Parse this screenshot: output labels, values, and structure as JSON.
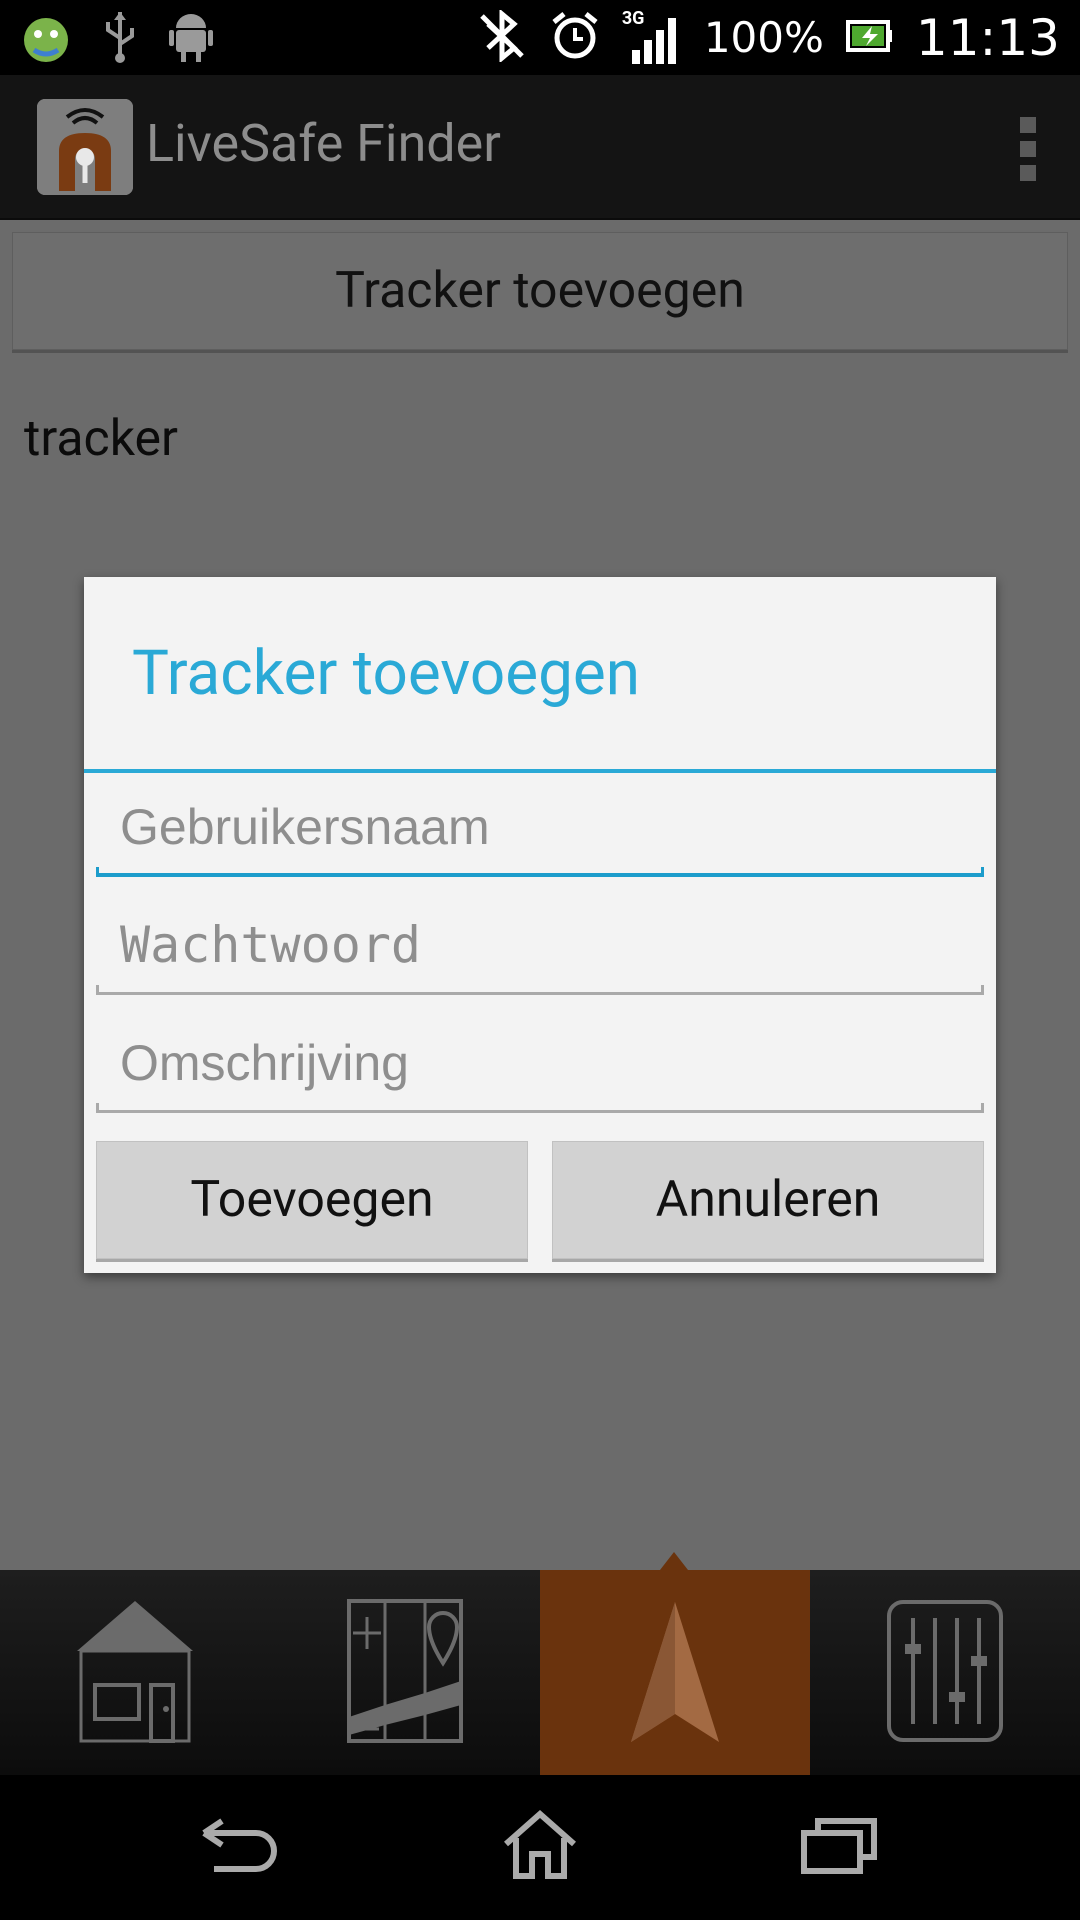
{
  "status_bar": {
    "network": "3G",
    "battery_percent": "100%",
    "time": "11:13",
    "icons": [
      "android-debug-icon",
      "usb-icon",
      "android-icon",
      "bluetooth-off-icon",
      "alarm-icon",
      "signal-icon",
      "battery-charging-icon"
    ]
  },
  "app_bar": {
    "title": "LiveSafe Finder",
    "icon": "livesafe-app-icon",
    "menu_icon": "overflow-menu-icon"
  },
  "content": {
    "top_button_label": "Tracker toevoegen",
    "list_item_label": "tracker"
  },
  "dialog": {
    "title": "Tracker toevoegen",
    "fields": {
      "username_placeholder": "Gebruikersnaam",
      "password_placeholder": "Wachtwoord",
      "description_placeholder": "Omschrijving"
    },
    "add_button": "Toevoegen",
    "cancel_button": "Annuleren"
  },
  "tabs": [
    {
      "icon": "home-icon",
      "active": false
    },
    {
      "icon": "map-icon",
      "active": false
    },
    {
      "icon": "navigation-arrow-icon",
      "active": true
    },
    {
      "icon": "settings-sliders-icon",
      "active": false
    }
  ],
  "nav_bar": [
    "back-icon",
    "home-nav-icon",
    "recent-apps-icon"
  ],
  "colors": {
    "accent": "#2aa9d6",
    "active_tab": "#6a330d",
    "dim_background": "#6b6b6b"
  }
}
